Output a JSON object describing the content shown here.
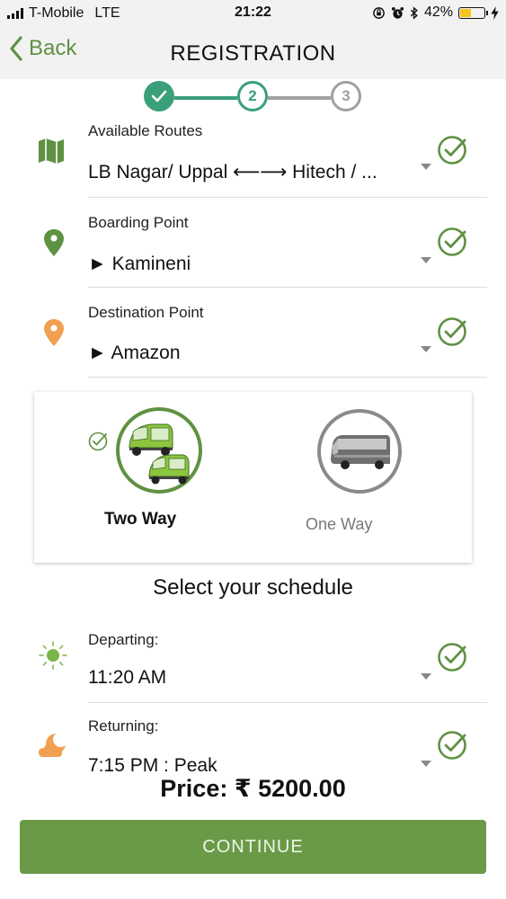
{
  "status_bar": {
    "carrier": "T-Mobile",
    "network": "LTE",
    "time": "21:22",
    "battery": "42%",
    "battery_level": 0.42
  },
  "nav": {
    "back_label": "Back",
    "title": "REGISTRATION"
  },
  "stepper": {
    "steps": [
      {
        "label": "",
        "state": "done"
      },
      {
        "label": "2",
        "state": "active"
      },
      {
        "label": "3",
        "state": "pending"
      }
    ]
  },
  "route": {
    "available_routes": {
      "label": "Available Routes",
      "value": "LB Nagar/ Uppal ⟵⟶ Hitech / ..."
    },
    "boarding_point": {
      "label": "Boarding Point",
      "value": "► Kamineni"
    },
    "destination_point": {
      "label": "Destination Point",
      "value": "► Amazon"
    }
  },
  "trip_type": {
    "options": [
      {
        "label": "Two Way",
        "selected": true,
        "icon": "two-auto-rickshaws"
      },
      {
        "label": "One Way",
        "selected": false,
        "icon": "bus"
      }
    ]
  },
  "schedule": {
    "heading": "Select your schedule",
    "departing": {
      "label": "Departing:",
      "value": "11:20 AM",
      "icon": "sun-icon"
    },
    "returning": {
      "label": "Returning:",
      "value": "7:15 PM : Peak",
      "icon": "moon-cloud-icon"
    }
  },
  "price": "Price: ₹ 5200.00",
  "continue_label": "CONTINUE",
  "colors": {
    "accent": "#5f9142",
    "button": "#6a9a48",
    "active_step": "#3aa07a",
    "pending": "#a0a0a0",
    "orange": "#f0a050"
  }
}
